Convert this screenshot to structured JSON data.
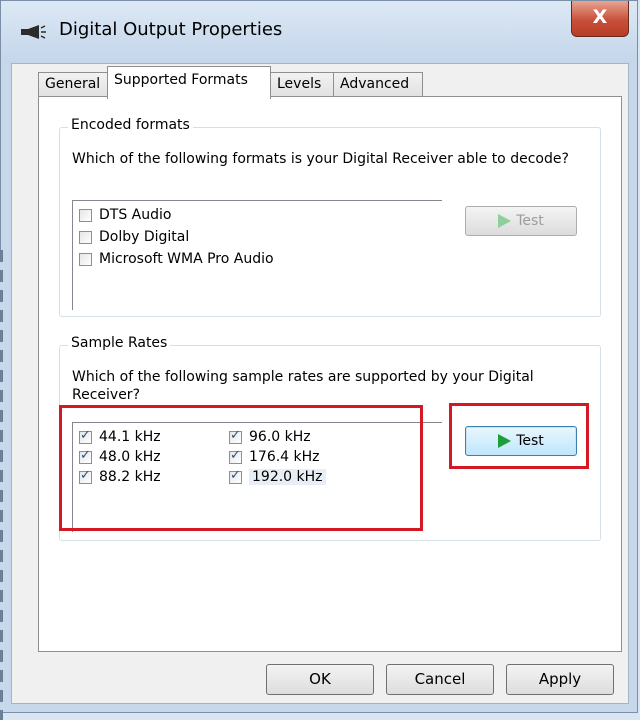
{
  "window": {
    "title": "Digital Output Properties",
    "close_label": "X"
  },
  "tabs": [
    {
      "label": "General"
    },
    {
      "label": "Supported Formats"
    },
    {
      "label": "Levels"
    },
    {
      "label": "Advanced"
    }
  ],
  "active_tab": "Supported Formats",
  "encoded": {
    "title": "Encoded formats",
    "description": "Which of the following formats is your Digital Receiver able to decode?",
    "items": [
      {
        "label": "DTS Audio",
        "checked": false
      },
      {
        "label": "Dolby Digital",
        "checked": false
      },
      {
        "label": "Microsoft WMA Pro Audio",
        "checked": false
      }
    ],
    "test_label": "Test",
    "test_enabled": false
  },
  "rates": {
    "title": "Sample Rates",
    "description": "Which of the following sample rates are supported by your Digital Receiver?",
    "col1": [
      {
        "label": "44.1 kHz",
        "checked": true
      },
      {
        "label": "48.0 kHz",
        "checked": true
      },
      {
        "label": "88.2 kHz",
        "checked": true
      }
    ],
    "col2": [
      {
        "label": "96.0 kHz",
        "checked": true
      },
      {
        "label": "176.4 kHz",
        "checked": true
      },
      {
        "label": "192.0 kHz",
        "checked": true
      }
    ],
    "test_label": "Test",
    "test_enabled": true
  },
  "buttons": {
    "ok": "OK",
    "cancel": "Cancel",
    "apply": "Apply"
  },
  "colors": {
    "highlight_box": "#d31a24",
    "play_icon": "#1e9d3b"
  },
  "icons": {
    "title": "speaker-icon",
    "test": "play-icon"
  }
}
